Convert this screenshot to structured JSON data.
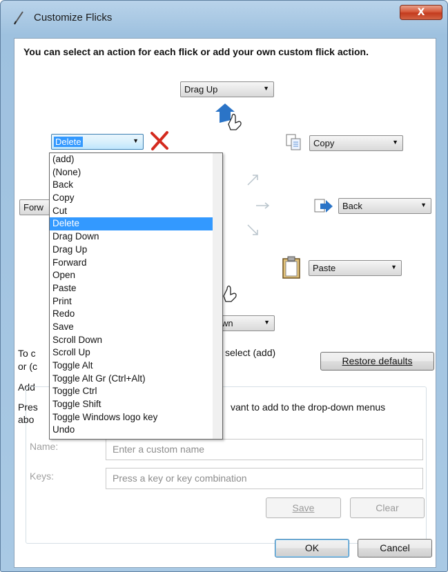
{
  "window": {
    "title": "Customize Flicks",
    "close_symbol": "X"
  },
  "heading": "You can select an action for each flick or add your own custom flick action.",
  "flicks": {
    "up": "Drag Up",
    "up_left": "Delete",
    "up_right": "Copy",
    "left": "Forw",
    "right": "Back",
    "down_right": "Paste",
    "down": "wn"
  },
  "dropdown": {
    "selected": "Delete",
    "options": [
      "(add)",
      "(None)",
      "Back",
      "Copy",
      "Cut",
      "Delete",
      "Drag Down",
      "Drag Up",
      "Forward",
      "Open",
      "Paste",
      "Print",
      "Redo",
      "Save",
      "Scroll Down",
      "Scroll Up",
      "Toggle Alt",
      "Toggle Alt Gr (Ctrl+Alt)",
      "Toggle Ctrl",
      "Toggle Shift",
      "Toggle Windows logo key",
      "Undo"
    ]
  },
  "hint": {
    "line1_prefix": "To c",
    "line1_suffix": "select (add)",
    "line2_prefix": "or (c"
  },
  "restore_button": "Restore defaults",
  "add_section": {
    "title_prefix": "Add",
    "desc_prefix_1": "Pres",
    "desc_suffix_1": "vant to add to the drop-down menus",
    "desc_prefix_2": "abo",
    "name_label": "Name:",
    "name_placeholder": "Enter a custom name",
    "keys_label": "Keys:",
    "keys_placeholder": "Press a key or key combination",
    "save_label": "Save",
    "clear_label": "Clear"
  },
  "footer": {
    "ok_label": "OK",
    "cancel_label": "Cancel"
  },
  "colors": {
    "accent": "#3399ff",
    "delete_x": "#d42a1e",
    "flick_arrow": "#2b74c7"
  }
}
